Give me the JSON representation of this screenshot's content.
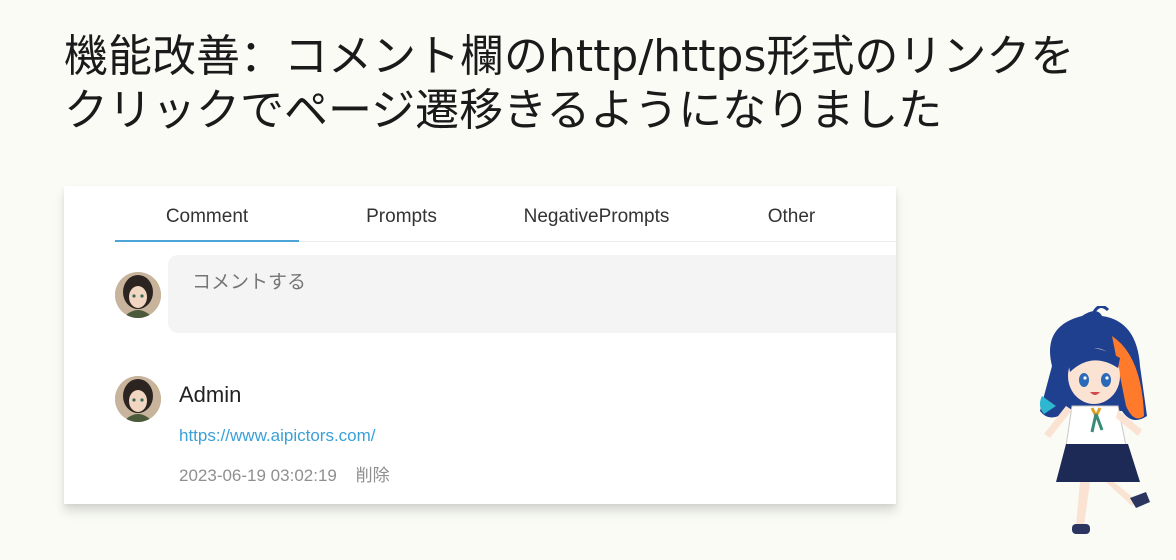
{
  "headline": {
    "line1": "機能改善：コメント欄のhttp/https形式のリンクを",
    "line2": "クリックでページ遷移きるようになりました"
  },
  "tabs": [
    {
      "label": "Comment",
      "active": true
    },
    {
      "label": "Prompts",
      "active": false
    },
    {
      "label": "NegativePrompts",
      "active": false
    },
    {
      "label": "Other",
      "active": false
    }
  ],
  "comment_input": {
    "placeholder": "コメントする",
    "value": ""
  },
  "comment": {
    "author": "Admin",
    "link": "https://www.aipictors.com/",
    "timestamp": "2023-06-19 03:02:19",
    "delete_label": "削除"
  },
  "colors": {
    "accent": "#4ba3d8",
    "link": "#3aa0d8",
    "muted": "#8f8f8f"
  },
  "icons": [
    "avatar-image",
    "avatar-image",
    "mascot-illustration"
  ]
}
